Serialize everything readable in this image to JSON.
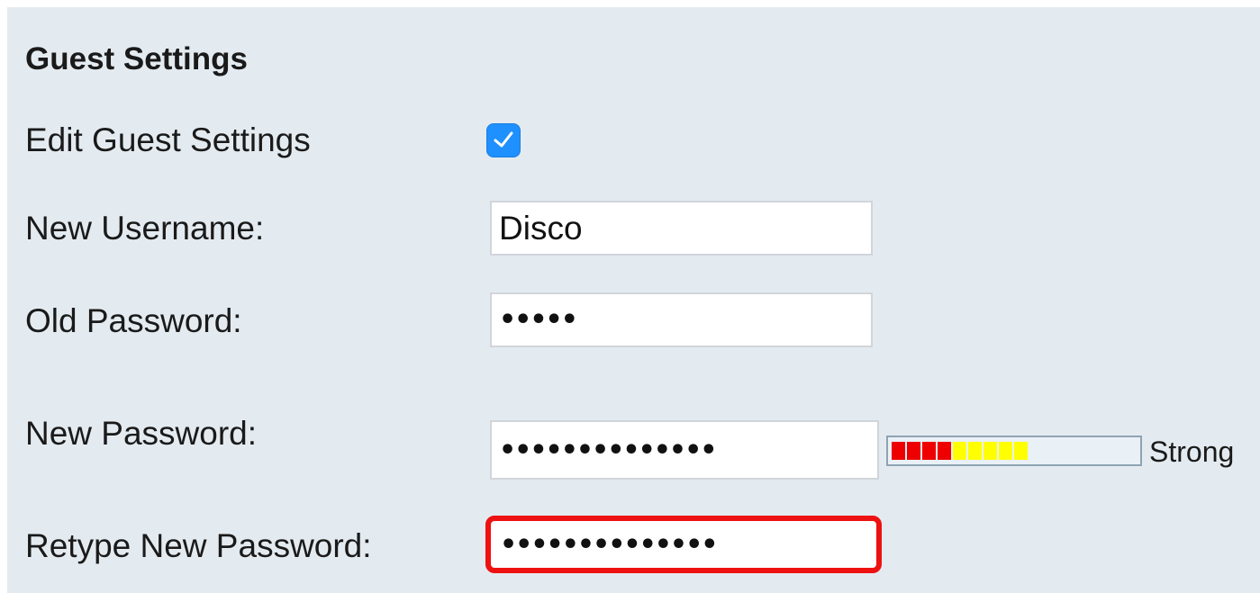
{
  "section": {
    "title": "Guest Settings"
  },
  "edit_guest": {
    "label": "Edit Guest Settings",
    "checked": true
  },
  "new_username": {
    "label": "New Username:",
    "value": "Disco"
  },
  "old_password": {
    "label": "Old Password:",
    "value": "•••••"
  },
  "new_password": {
    "label": "New Password:",
    "value": "••••••••••••••",
    "strength": {
      "label": "Strong",
      "filled_segments": 9,
      "segment_colors": [
        "#ee0000",
        "#ee0000",
        "#ee0000",
        "#ee0000",
        "#ffff00",
        "#ffff00",
        "#ffff00",
        "#ffff00",
        "#ffff00"
      ],
      "empty_color": "#e9f0f6"
    }
  },
  "retype_password": {
    "label": "Retype New Password:",
    "value": "••••••••••••••",
    "highlight_color": "#ee1111"
  },
  "colors": {
    "panel_bg": "#e4ebf0",
    "checkbox_accent": "#1e90ff"
  }
}
